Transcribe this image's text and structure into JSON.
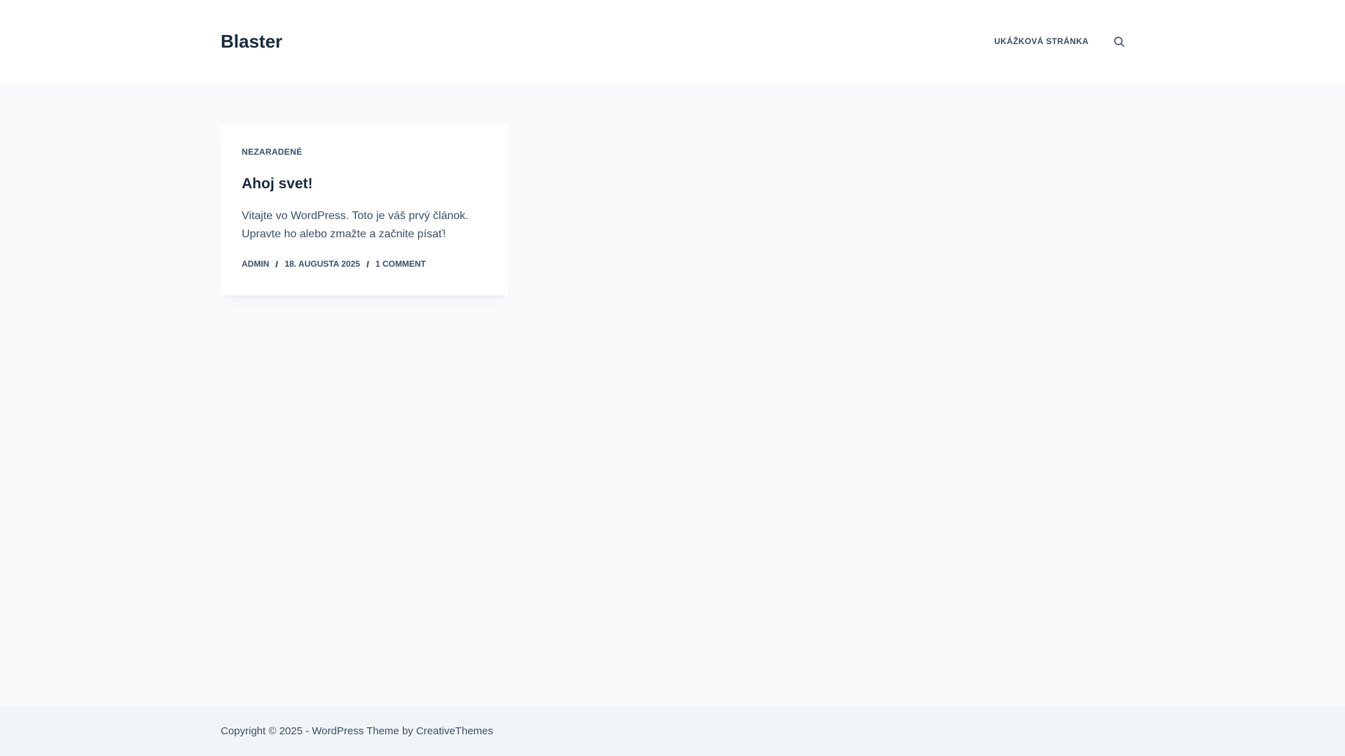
{
  "header": {
    "site_title": "Blaster",
    "nav": [
      {
        "label": "UKÁŽKOVÁ STRÁNKA"
      }
    ],
    "search_icon": "search-icon"
  },
  "post": {
    "category": "NEZARADENÉ",
    "title": "Ahoj svet!",
    "excerpt": "Vitajte vo WordPress. Toto je váš prvý článok. Upravte ho alebo zmažte a začnite písať!",
    "meta": {
      "author": "ADMIN",
      "date": "18. AUGUSTA 2025",
      "comments": "1 COMMENT"
    }
  },
  "footer": {
    "copyright_prefix": "Copyright © 2025 - WordPress Theme by ",
    "theme_author": "CreativeThemes"
  },
  "colors": {
    "heading": "#192a3d",
    "text": "#3a4f66",
    "background": "#f9fafb",
    "footer_background": "#f2f5f7"
  }
}
